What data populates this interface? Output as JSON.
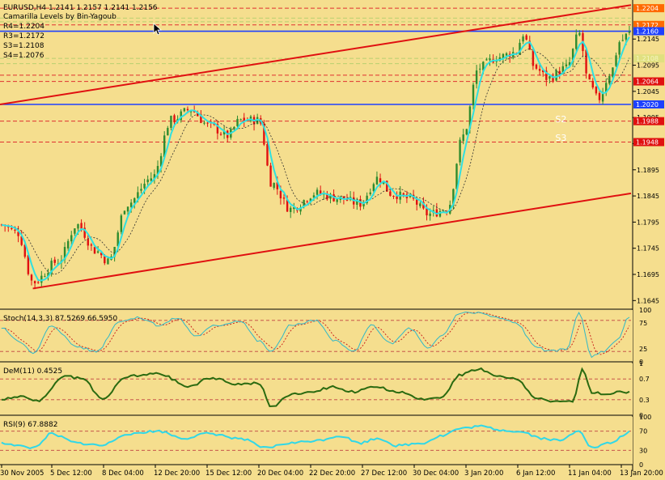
{
  "chart_data": {
    "type": "candlestick",
    "symbol_line": "EURUSD,H4  1.2141 1.2157 1.2141 1.2156",
    "indicator_name": "Camarilla Levels by Bin-Yagoub",
    "level_labels": [
      "R4=1.2204",
      "R3=1.2172",
      "S3=1.2108",
      "S4=1.2076"
    ],
    "main_ylim": [
      1.163,
      1.2215
    ],
    "price_ticks": [
      "1.2145",
      "1.2095",
      "1.2045",
      "1.1995",
      "1.1945",
      "1.1895",
      "1.1845",
      "1.1795",
      "1.1745",
      "1.1695",
      "1.1645"
    ],
    "level_boxes": [
      {
        "price": 1.2204,
        "label": "1.2204",
        "color": "#FF6A00"
      },
      {
        "price": 1.2172,
        "label": "1.2172",
        "color": "#FF6A00"
      },
      {
        "price": 1.216,
        "label": "1.2160",
        "color": "#1E40FF"
      },
      {
        "price": 1.2108,
        "label": "1.2108",
        "color": "#E0E080"
      },
      {
        "price": 1.2064,
        "label": "1.2064",
        "color": "#E01010"
      },
      {
        "price": 1.202,
        "label": "1.2020",
        "color": "#1E40FF"
      },
      {
        "price": 1.1988,
        "label": "1.1988",
        "color": "#E01010"
      },
      {
        "price": 1.1948,
        "label": "1.1948",
        "color": "#E01010"
      }
    ],
    "dashed_levels": [
      {
        "price": 1.2204,
        "color": "#E03030"
      },
      {
        "price": 1.2185,
        "color": "#B8D070"
      },
      {
        "price": 1.2178,
        "color": "#B8D070"
      },
      {
        "price": 1.2172,
        "color": "#E03030"
      },
      {
        "price": 1.2108,
        "color": "#B8D070"
      },
      {
        "price": 1.2098,
        "color": "#B8D070"
      },
      {
        "price": 1.2076,
        "color": "#E03030"
      },
      {
        "price": 1.2064,
        "color": "#E03030"
      },
      {
        "price": 1.1988,
        "color": "#E03030"
      },
      {
        "price": 1.1948,
        "color": "#E03030"
      }
    ],
    "solid_levels": [
      {
        "price": 1.216,
        "color": "#1E40FF"
      },
      {
        "price": 1.202,
        "color": "#1E40FF"
      }
    ],
    "trendlines": [
      {
        "x1": 0,
        "y1": 1.202,
        "x2": 1,
        "y2": 1.221,
        "color": "#E01010"
      },
      {
        "x1": 0.052,
        "y1": 1.1668,
        "x2": 1,
        "y2": 1.185,
        "color": "#E01010"
      }
    ],
    "pivot_text_labels": [
      {
        "label": "S2",
        "price": 1.1986,
        "xfrac": 0.88
      },
      {
        "label": "S3",
        "price": 1.195,
        "xfrac": 0.88
      }
    ],
    "close_anchors": [
      [
        0,
        1.179
      ],
      [
        0.025,
        1.1775
      ],
      [
        0.05,
        1.168
      ],
      [
        0.09,
        1.172
      ],
      [
        0.12,
        1.179
      ],
      [
        0.15,
        1.174
      ],
      [
        0.17,
        1.172
      ],
      [
        0.2,
        1.183
      ],
      [
        0.24,
        1.188
      ],
      [
        0.27,
        1.199
      ],
      [
        0.3,
        1.201
      ],
      [
        0.33,
        1.198
      ],
      [
        0.36,
        1.196
      ],
      [
        0.38,
        1.199
      ],
      [
        0.41,
        1.199
      ],
      [
        0.43,
        1.187
      ],
      [
        0.46,
        1.182
      ],
      [
        0.5,
        1.185
      ],
      [
        0.54,
        1.184
      ],
      [
        0.57,
        1.183
      ],
      [
        0.6,
        1.188
      ],
      [
        0.62,
        1.185
      ],
      [
        0.65,
        1.184
      ],
      [
        0.68,
        1.181
      ],
      [
        0.71,
        1.182
      ],
      [
        0.735,
        1.196
      ],
      [
        0.76,
        1.209
      ],
      [
        0.79,
        1.211
      ],
      [
        0.82,
        1.212
      ],
      [
        0.83,
        1.2155
      ],
      [
        0.85,
        1.209
      ],
      [
        0.87,
        1.207
      ],
      [
        0.9,
        1.209
      ],
      [
        0.92,
        1.2155
      ],
      [
        0.935,
        1.206
      ],
      [
        0.95,
        1.203
      ],
      [
        0.97,
        1.208
      ],
      [
        0.985,
        1.214
      ],
      [
        1.0,
        1.2156
      ]
    ],
    "stoch": {
      "label": "Stoch(14,3,3) 87.5269 66.5950",
      "ylim": [
        0,
        100
      ],
      "ticks": [
        "100",
        "75",
        "25",
        "0"
      ],
      "levels": [
        80,
        20
      ],
      "main_color": "#30B8C8",
      "signal_color": "#C81818",
      "anchors": [
        [
          0,
          65
        ],
        [
          0.03,
          40
        ],
        [
          0.05,
          15
        ],
        [
          0.08,
          70
        ],
        [
          0.12,
          30
        ],
        [
          0.15,
          20
        ],
        [
          0.19,
          80
        ],
        [
          0.22,
          85
        ],
        [
          0.25,
          70
        ],
        [
          0.28,
          85
        ],
        [
          0.31,
          50
        ],
        [
          0.34,
          70
        ],
        [
          0.38,
          80
        ],
        [
          0.41,
          40
        ],
        [
          0.43,
          20
        ],
        [
          0.46,
          70
        ],
        [
          0.5,
          80
        ],
        [
          0.53,
          40
        ],
        [
          0.56,
          20
        ],
        [
          0.59,
          70
        ],
        [
          0.62,
          35
        ],
        [
          0.65,
          65
        ],
        [
          0.68,
          25
        ],
        [
          0.7,
          50
        ],
        [
          0.73,
          95
        ],
        [
          0.76,
          95
        ],
        [
          0.79,
          85
        ],
        [
          0.82,
          75
        ],
        [
          0.85,
          30
        ],
        [
          0.87,
          20
        ],
        [
          0.9,
          25
        ],
        [
          0.92,
          95
        ],
        [
          0.94,
          10
        ],
        [
          0.96,
          20
        ],
        [
          0.98,
          40
        ],
        [
          1.0,
          87
        ]
      ]
    },
    "dem": {
      "label": "DeM(11) 0.4525",
      "ylim": [
        0,
        1
      ],
      "ticks": [
        "1",
        "0.7",
        "0.3",
        "0"
      ],
      "levels": [
        0.7,
        0.3
      ],
      "color": "#2A6A10",
      "anchors": [
        [
          0,
          0.32
        ],
        [
          0.03,
          0.35
        ],
        [
          0.06,
          0.28
        ],
        [
          0.1,
          0.75
        ],
        [
          0.13,
          0.7
        ],
        [
          0.16,
          0.3
        ],
        [
          0.2,
          0.75
        ],
        [
          0.25,
          0.8
        ],
        [
          0.3,
          0.55
        ],
        [
          0.33,
          0.72
        ],
        [
          0.38,
          0.6
        ],
        [
          0.41,
          0.62
        ],
        [
          0.43,
          0.15
        ],
        [
          0.46,
          0.4
        ],
        [
          0.49,
          0.45
        ],
        [
          0.53,
          0.55
        ],
        [
          0.56,
          0.45
        ],
        [
          0.6,
          0.55
        ],
        [
          0.63,
          0.45
        ],
        [
          0.67,
          0.3
        ],
        [
          0.7,
          0.35
        ],
        [
          0.73,
          0.78
        ],
        [
          0.76,
          0.9
        ],
        [
          0.79,
          0.75
        ],
        [
          0.82,
          0.7
        ],
        [
          0.85,
          0.35
        ],
        [
          0.88,
          0.25
        ],
        [
          0.91,
          0.28
        ],
        [
          0.925,
          0.88
        ],
        [
          0.94,
          0.45
        ],
        [
          0.96,
          0.4
        ],
        [
          0.98,
          0.45
        ],
        [
          1.0,
          0.45
        ]
      ]
    },
    "rsi": {
      "label": "RSI(9) 67.8882",
      "ylim": [
        0,
        100
      ],
      "ticks": [
        "100",
        "70",
        "30",
        "0"
      ],
      "levels": [
        70,
        30
      ],
      "color": "#30D8E8",
      "anchors": [
        [
          0,
          45
        ],
        [
          0.05,
          35
        ],
        [
          0.08,
          65
        ],
        [
          0.12,
          45
        ],
        [
          0.16,
          40
        ],
        [
          0.2,
          65
        ],
        [
          0.25,
          70
        ],
        [
          0.29,
          55
        ],
        [
          0.33,
          65
        ],
        [
          0.38,
          55
        ],
        [
          0.42,
          35
        ],
        [
          0.46,
          45
        ],
        [
          0.5,
          50
        ],
        [
          0.54,
          60
        ],
        [
          0.57,
          45
        ],
        [
          0.6,
          55
        ],
        [
          0.63,
          40
        ],
        [
          0.67,
          45
        ],
        [
          0.7,
          60
        ],
        [
          0.73,
          75
        ],
        [
          0.76,
          80
        ],
        [
          0.8,
          72
        ],
        [
          0.83,
          68
        ],
        [
          0.86,
          55
        ],
        [
          0.89,
          50
        ],
        [
          0.92,
          72
        ],
        [
          0.94,
          35
        ],
        [
          0.97,
          45
        ],
        [
          1.0,
          68
        ]
      ]
    },
    "x_labels": [
      "30 Nov 2005",
      "5 Dec 12:00",
      "8 Dec 04:00",
      "12 Dec 20:00",
      "15 Dec 12:00",
      "20 Dec 04:00",
      "22 Dec 20:00",
      "27 Dec 12:00",
      "30 Dec 04:00",
      "3 Jan 20:00",
      "6 Jan 12:00",
      "11 Jan 04:00",
      "13 Jan 20:00"
    ],
    "colors": {
      "background": "#F5DE8E",
      "frame": "#000000",
      "bull": "#2E8B2E",
      "bear": "#E01010",
      "ma_fast": "#2FE0E0",
      "ma_slow": "#303030",
      "grid_dash": "#C04040"
    }
  }
}
